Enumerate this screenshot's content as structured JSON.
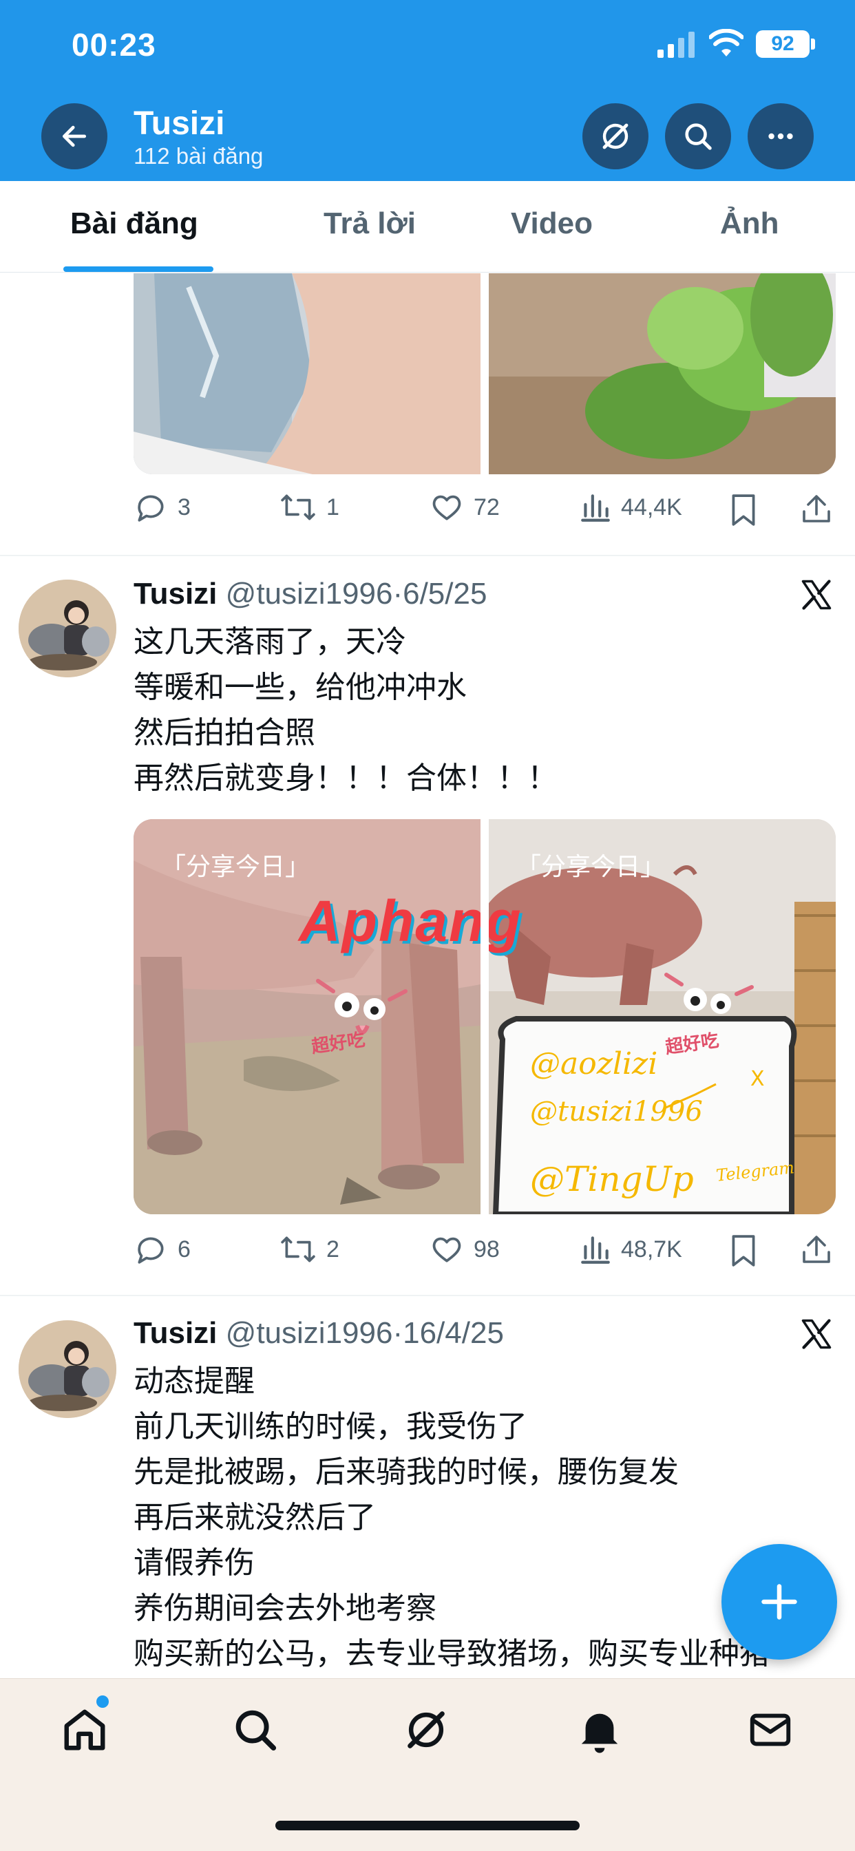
{
  "status_bar": {
    "time": "00:23",
    "battery": "92"
  },
  "header": {
    "title": "Tusizi",
    "subtitle": "112 bài đăng"
  },
  "tabs": [
    {
      "label": "Bài đăng"
    },
    {
      "label": "Trả lời"
    },
    {
      "label": "Video"
    },
    {
      "label": "Ảnh"
    }
  ],
  "prev_tweet_actions": {
    "replies": "3",
    "reposts": "1",
    "likes": "72",
    "views": "44,4K"
  },
  "tweets": [
    {
      "name": "Tusizi",
      "handle": "@tusizi1996",
      "sep": "·",
      "date": "6/5/25",
      "lines": [
        "这几天落雨了，天冷",
        "等暖和一些，给他冲冲水",
        "然后拍拍合照",
        "再然后就变身！！！合体！！！"
      ],
      "media": {
        "left": {
          "caption": "「分享今日」",
          "sticker": "超好吃"
        },
        "right": {
          "caption": "「分享今日」",
          "sticker": "超好吃",
          "board_lines": [
            "@aozlizi",
            "@tusizi1996",
            "@TingUp",
            "X",
            "Telegram"
          ]
        },
        "watermark": "Aphang"
      },
      "actions": {
        "replies": "6",
        "reposts": "2",
        "likes": "98",
        "views": "48,7K"
      }
    },
    {
      "name": "Tusizi",
      "handle": "@tusizi1996",
      "sep": "·",
      "date": "16/4/25",
      "lines": [
        "动态提醒",
        "前几天训练的时候，我受伤了",
        "先是批被踢，后来骑我的时候，腰伤复发",
        "再后来就没然后了",
        "请假养伤",
        "养伤期间会去外地考察",
        "购买新的公马，去专业导致猪场，购买专业种猪"
      ]
    }
  ],
  "colors": {
    "header_blue": "#2196ea",
    "accent": "#1d9bf0",
    "text": "#0f1419",
    "muted": "#536471"
  },
  "icons": [
    "back-arrow-icon",
    "grok-icon",
    "search-icon",
    "more-icon",
    "reply-icon",
    "repost-icon",
    "like-icon",
    "views-icon",
    "bookmark-icon",
    "share-icon",
    "x-logo-icon",
    "plus-icon",
    "home-icon",
    "bell-icon",
    "mail-icon"
  ]
}
